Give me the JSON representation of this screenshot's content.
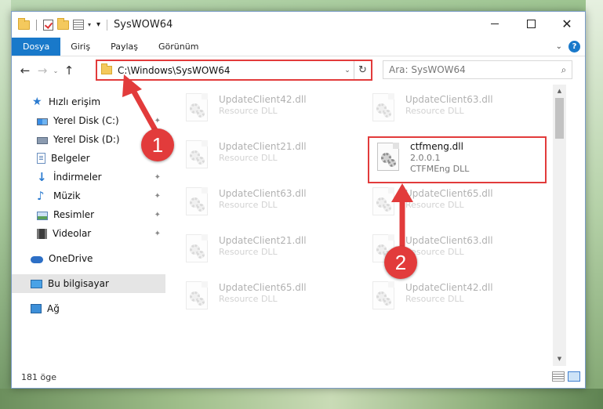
{
  "window": {
    "title": "SysWOW64",
    "controls": {
      "minimize": "",
      "maximize": "",
      "close": "✕"
    }
  },
  "quick_access_toolbar": {
    "dropdown": "▾",
    "customize": "▾"
  },
  "ribbon": {
    "tabs": [
      "Dosya",
      "Giriş",
      "Paylaş",
      "Görünüm"
    ],
    "collapse": "⌄",
    "help": "?"
  },
  "navigation": {
    "back": "←",
    "forward": "→",
    "recent": "⌄",
    "up": "↑"
  },
  "address_bar": {
    "path": "C:\\Windows\\SysWOW64",
    "dropdown": "⌄",
    "refresh": "↻"
  },
  "search": {
    "placeholder": "Ara: SysWOW64",
    "icon": "⌕"
  },
  "sidebar": {
    "items": [
      {
        "label": "Hızlı erişim",
        "icon": "star-icon"
      },
      {
        "label": "Yerel Disk (C:)",
        "icon": "drive-icon",
        "pinned": true
      },
      {
        "label": "Yerel Disk (D:)",
        "icon": "drive-icon",
        "pinned": true
      },
      {
        "label": "Belgeler",
        "icon": "document-icon",
        "pinned": true
      },
      {
        "label": "İndirmeler",
        "icon": "download-icon",
        "pinned": true
      },
      {
        "label": "Müzik",
        "icon": "music-icon",
        "pinned": true
      },
      {
        "label": "Resimler",
        "icon": "pictures-icon",
        "pinned": true
      },
      {
        "label": "Videolar",
        "icon": "video-icon",
        "pinned": true
      },
      {
        "label": "OneDrive",
        "icon": "cloud-icon"
      },
      {
        "label": "Bu bilgisayar",
        "icon": "computer-icon",
        "selected": true
      },
      {
        "label": "Ağ",
        "icon": "network-icon"
      }
    ],
    "pin_glyph": "📌"
  },
  "files": [
    {
      "name": "UpdateClient42.dll",
      "type": "Resource DLL",
      "faded": true
    },
    {
      "name": "UpdateClient63.dll",
      "type": "Resource DLL",
      "faded": true
    },
    {
      "name": "UpdateClient21.dll",
      "type": "Resource DLL",
      "faded": true
    },
    {
      "name": "ctfmeng.dll",
      "version": "2.0.0.1",
      "type": "CTFMEng DLL",
      "highlighted": true
    },
    {
      "name": "UpdateClient63.dll",
      "type": "Resource DLL",
      "faded": true
    },
    {
      "name": "UpdateClient65.dll",
      "type": "Resource DLL",
      "faded": true
    },
    {
      "name": "UpdateClient21.dll",
      "type": "Resource DLL",
      "faded": true
    },
    {
      "name": "UpdateClient63.dll",
      "type": "Resource DLL",
      "faded": true
    },
    {
      "name": "UpdateClient65.dll",
      "type": "Resource DLL",
      "faded": true
    },
    {
      "name": "UpdateClient42.dll",
      "type": "Resource DLL",
      "faded": true
    }
  ],
  "scrollbar": {
    "up": "▲",
    "down": "▼"
  },
  "status": {
    "count": "181 öge"
  },
  "annotations": {
    "step1": "1",
    "step2": "2",
    "color": "#e23b3b"
  },
  "colors": {
    "accent": "#1979ca",
    "highlight_box": "#e23b3b",
    "selected_bg": "#e5e5e5"
  }
}
